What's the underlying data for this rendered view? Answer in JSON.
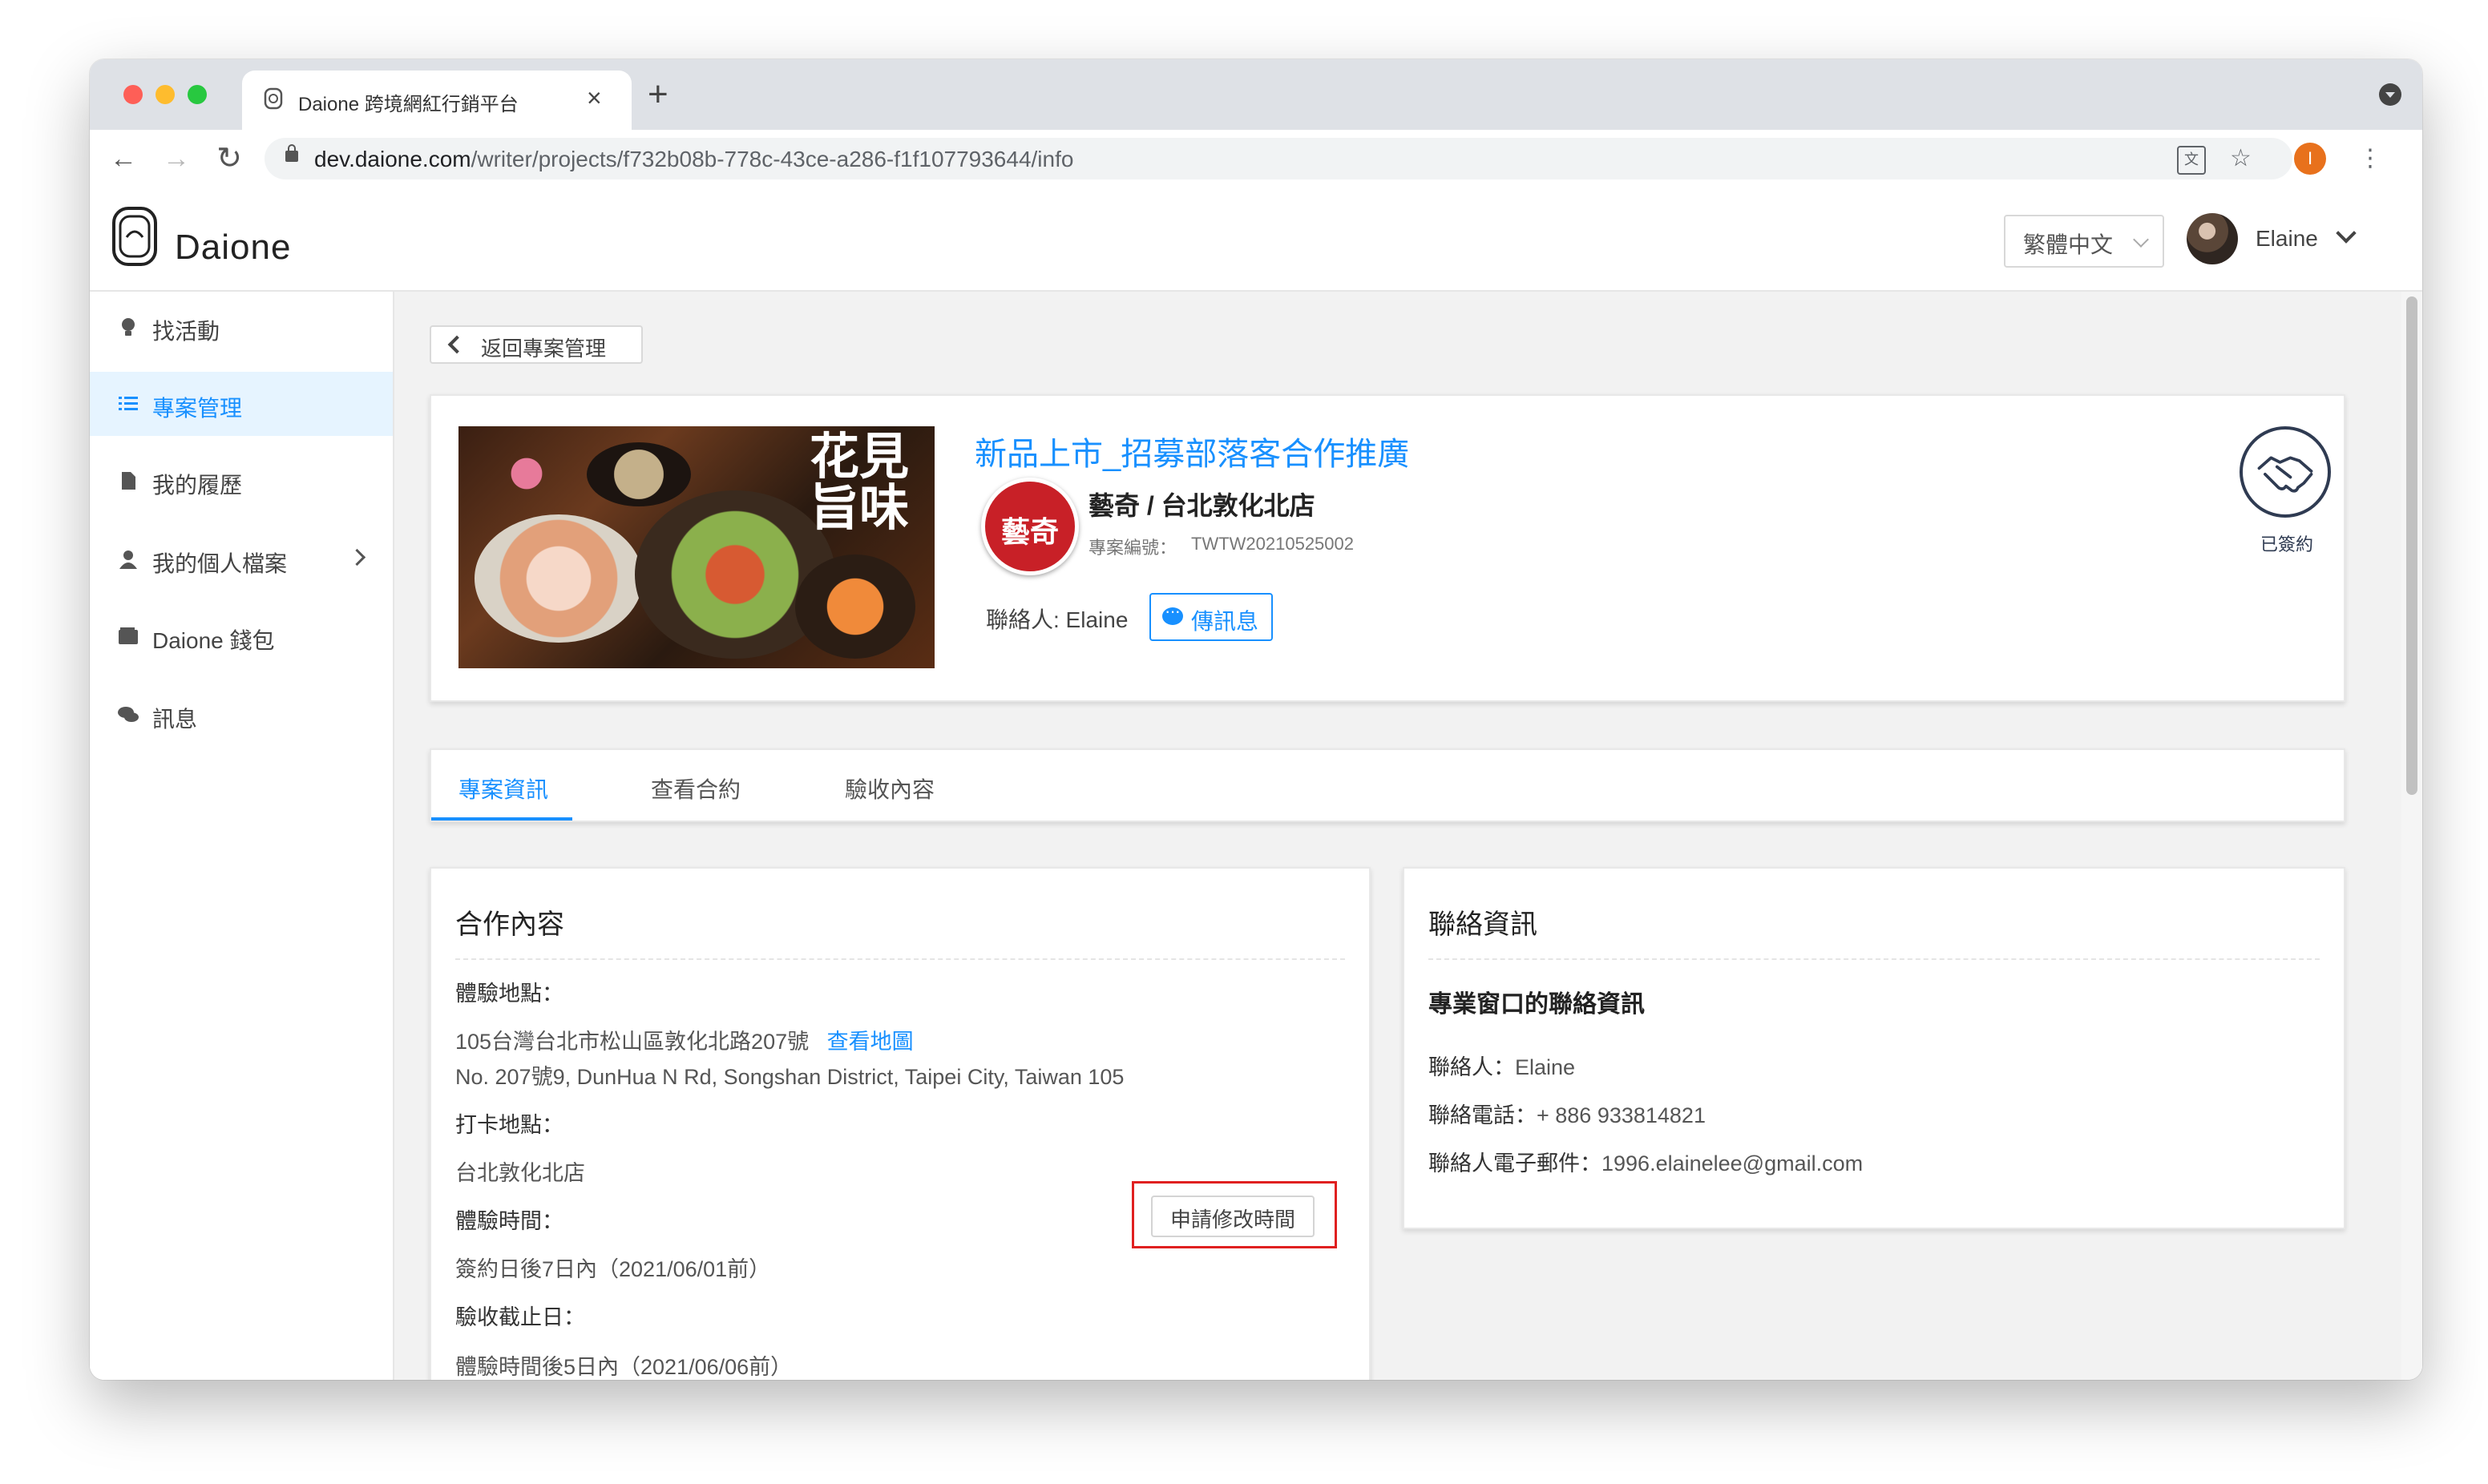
{
  "browser": {
    "tab_title": "Daione 跨境網紅行銷平台",
    "tab_close": "×",
    "new_tab": "+",
    "url_host": "dev.daione.com",
    "url_path": "/writer/projects/f732b08b-778c-43ce-a286-f1f107793644/info",
    "profile_initial": "I",
    "icons": [
      "back-icon",
      "forward-icon",
      "reload-icon",
      "lock-icon",
      "translate-icon",
      "star-icon",
      "menu-icon"
    ]
  },
  "header": {
    "logo_text": "Daione",
    "language": "繁體中文",
    "user_name": "Elaine"
  },
  "sidebar": {
    "items": [
      {
        "label": "找活動",
        "icon": "lightbulb-icon",
        "active": false
      },
      {
        "label": "專案管理",
        "icon": "list-icon",
        "active": true
      },
      {
        "label": "我的履歷",
        "icon": "file-icon",
        "active": false
      },
      {
        "label": "我的個人檔案",
        "icon": "user-icon",
        "active": false,
        "has_submenu": true
      },
      {
        "label": "Daione 錢包",
        "icon": "wallet-icon",
        "active": false
      },
      {
        "label": "訊息",
        "icon": "chat-icon",
        "active": false
      }
    ]
  },
  "back_button": "返回專案管理",
  "project": {
    "image_text": "花見旨味",
    "title": "新品上市_招募部落客合作推廣",
    "brand_logo_text": "藝奇",
    "store_name": "藝奇 / 台北敦化北店",
    "number_label": "專案編號：",
    "number": "TWTW20210525002",
    "contact": "聯絡人: Elaine",
    "message_button": "傳訊息",
    "status": "已簽約"
  },
  "tabs": [
    {
      "label": "專案資訊",
      "active": true
    },
    {
      "label": "查看合約",
      "active": false
    },
    {
      "label": "驗收內容",
      "active": false
    }
  ],
  "cooperation": {
    "title": "合作內容",
    "location_label": "體驗地點：",
    "address_zh": "105台灣台北市松山區敦化北路207號",
    "map_link": "查看地圖",
    "address_en": "No. 207號9, DunHua N Rd, Songshan District, Taipei City, Taiwan 105",
    "checkin_label": "打卡地點：",
    "checkin_value": "台北敦化北店",
    "time_label": "體驗時間：",
    "change_time_button": "申請修改時間",
    "time_value": "簽約日後7日內（2021/06/01前）",
    "deadline_label": "驗收截止日：",
    "deadline_value": "體驗時間後5日內（2021/06/06前）"
  },
  "contact_info": {
    "title": "聯絡資訊",
    "subtitle": "專業窗口的聯絡資訊",
    "person_label": "聯絡人：",
    "person": "Elaine",
    "phone_label": "聯絡電話：",
    "phone": "+ 886 933814821",
    "email_label": "聯絡人電子郵件：",
    "email": "1996.elainelee@gmail.com"
  },
  "colors": {
    "accent": "#1890ff",
    "highlight": "#e02020",
    "brand_red": "#c82027"
  }
}
